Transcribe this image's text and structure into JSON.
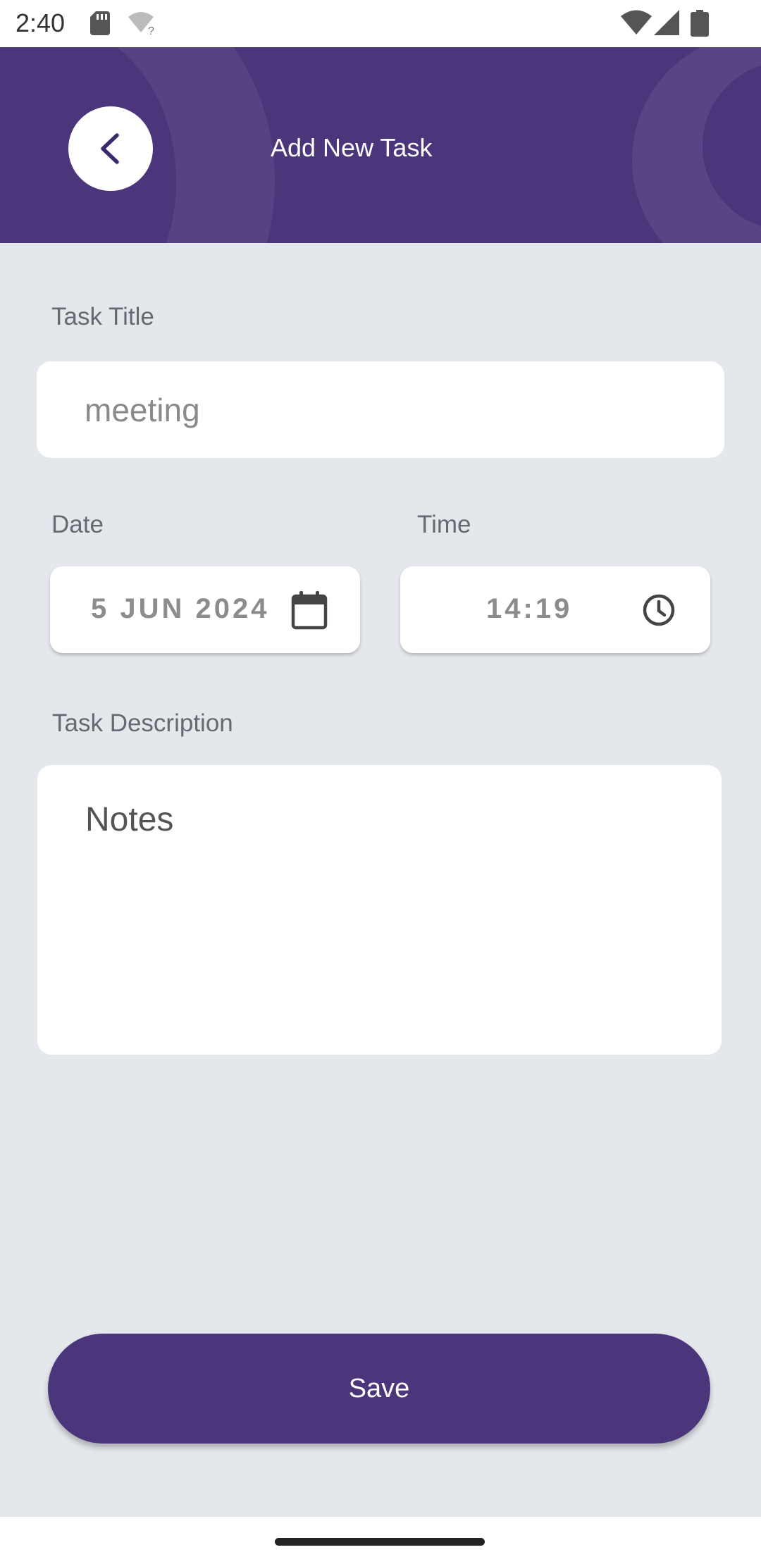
{
  "status_bar": {
    "time": "2:40",
    "icons": [
      "sd-card-icon",
      "wifi-unknown-icon",
      "wifi-icon",
      "signal-icon",
      "battery-icon"
    ]
  },
  "header": {
    "title": "Add New Task",
    "back_icon": "chevron-left-icon",
    "background_color": "#4b357b"
  },
  "form": {
    "task_title_label": "Task Title",
    "task_title_placeholder": "meeting",
    "task_title_value": "",
    "date_label": "Date",
    "date_value": "5 JUN 2024",
    "date_icon": "calendar-icon",
    "time_label": "Time",
    "time_value": "14:19",
    "time_icon": "clock-icon",
    "description_label": "Task Description",
    "description_placeholder": "Notes",
    "description_value": ""
  },
  "actions": {
    "save_label": "Save"
  },
  "colors": {
    "primary": "#4b357b",
    "background": "#e4e7ec",
    "card": "#ffffff"
  }
}
